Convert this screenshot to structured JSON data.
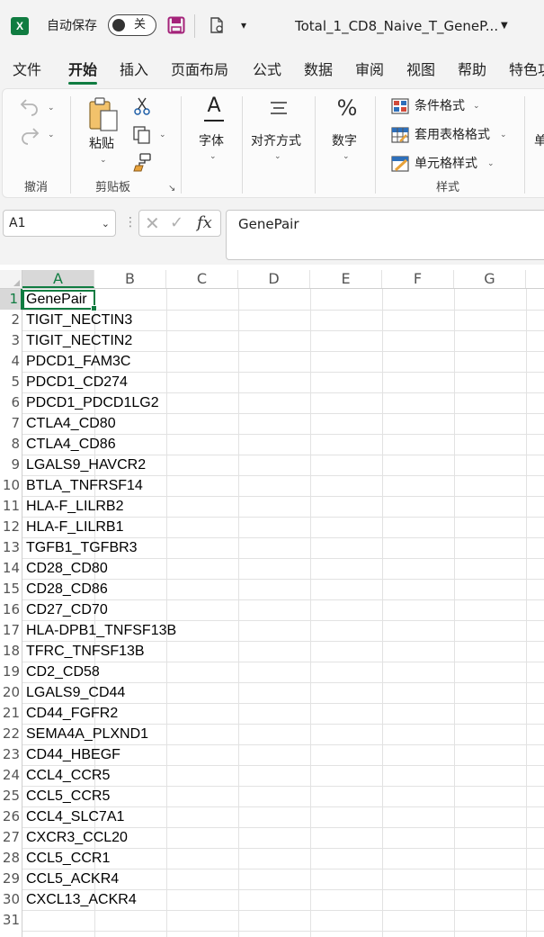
{
  "titlebar": {
    "autosave_label": "自动保存",
    "autosave_state": "关",
    "filename": "Total_1_CD8_Naive_T_GeneP...",
    "brand_color": "#107c41",
    "save_icon_color": "#a4237a"
  },
  "menu": {
    "tabs": [
      "文件",
      "开始",
      "插入",
      "页面布局",
      "公式",
      "数据",
      "审阅",
      "视图",
      "帮助",
      "特色功"
    ],
    "active_tab": "开始"
  },
  "ribbon": {
    "undo_group": "撤消",
    "paste_label": "粘贴",
    "clipboard_group": "剪贴板",
    "font_label": "字体",
    "font_icon_letter": "A",
    "align_label": "对齐方式",
    "number_label": "数字",
    "number_icon": "%",
    "conditional_format": "条件格式",
    "table_format": "套用表格格式",
    "cell_styles": "单元格样式",
    "styles_group": "样式",
    "cells_partial": "单"
  },
  "formula_bar": {
    "name_box": "A1",
    "fx_label": "fx",
    "content": "GenePair"
  },
  "sheet": {
    "columns": [
      "A",
      "B",
      "C",
      "D",
      "E",
      "F",
      "G"
    ],
    "selected_column": "A",
    "active_cell": "A1",
    "row_numbers": [
      "1",
      "2",
      "3",
      "4",
      "5",
      "6",
      "7",
      "8",
      "9",
      "10",
      "11",
      "12",
      "13",
      "14",
      "15",
      "16",
      "17",
      "18",
      "19",
      "20",
      "21",
      "22",
      "23",
      "24",
      "25",
      "26",
      "27",
      "28",
      "29",
      "30",
      "31"
    ],
    "column_a": [
      "GenePair",
      "TIGIT_NECTIN3",
      "TIGIT_NECTIN2",
      "PDCD1_FAM3C",
      "PDCD1_CD274",
      "PDCD1_PDCD1LG2",
      "CTLA4_CD80",
      "CTLA4_CD86",
      "LGALS9_HAVCR2",
      "BTLA_TNFRSF14",
      "HLA-F_LILRB2",
      "HLA-F_LILRB1",
      "TGFB1_TGFBR3",
      "CD28_CD80",
      "CD28_CD86",
      "CD27_CD70",
      "HLA-DPB1_TNFSF13B",
      "TFRC_TNFSF13B",
      "CD2_CD58",
      "LGALS9_CD44",
      "CD44_FGFR2",
      "SEMA4A_PLXND1",
      "CD44_HBEGF",
      "CCL4_CCR5",
      "CCL5_CCR5",
      "CCL4_SLC7A1",
      "CXCR3_CCL20",
      "CCL5_CCR1",
      "CCL5_ACKR4",
      "CXCL13_ACKR4",
      ""
    ]
  }
}
